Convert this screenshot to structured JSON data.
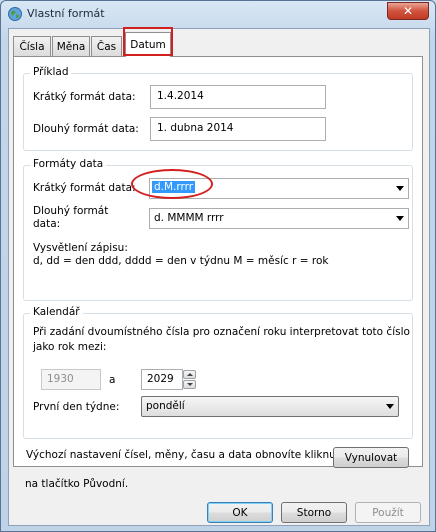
{
  "window": {
    "title": "Vlastní formát",
    "close_glyph": "✕"
  },
  "tabs": [
    {
      "label": "Čísla"
    },
    {
      "label": "Měna"
    },
    {
      "label": "Čas"
    },
    {
      "label": "Datum",
      "active": true
    }
  ],
  "example": {
    "title": "Příklad",
    "short_label": "Krátký formát data:",
    "short_value": "1.4.2014",
    "long_label": "Dlouhý formát data:",
    "long_value": "1. dubna 2014"
  },
  "formats": {
    "title": "Formáty data",
    "short_label": "Krátký formát data:",
    "short_value": "d.M.rrrr",
    "long_label_1": "Dlouhý formát",
    "long_label_2": "data:",
    "long_value": "d. MMMM rrrr",
    "notation_title": "Vysvětlení zápisu:",
    "notation_text": "d, dd = den  ddd, dddd = den v týdnu  M = měsíc  r = rok"
  },
  "calendar": {
    "title": "Kalendář",
    "desc_1": "Při zadání dvoumístného čísla pro označení roku interpretovat toto číslo",
    "desc_2": "jako rok mezi:",
    "year_from": "1930",
    "and_label": "a",
    "year_to": "2029",
    "first_day_label": "První den týdne:",
    "first_day_value": "pondělí"
  },
  "footer": {
    "reset_text_1": "Výchozí nastavení čísel, měny, času a data obnovíte kliknutím",
    "reset_text_2": "na tlačítko Původní.",
    "reset_button": "Vynulovat",
    "ok_button": "OK",
    "cancel_button": "Storno",
    "apply_button": "Použít"
  },
  "colors": {
    "annotation_red": "#d21f1f",
    "selection_blue": "#3399ff"
  }
}
